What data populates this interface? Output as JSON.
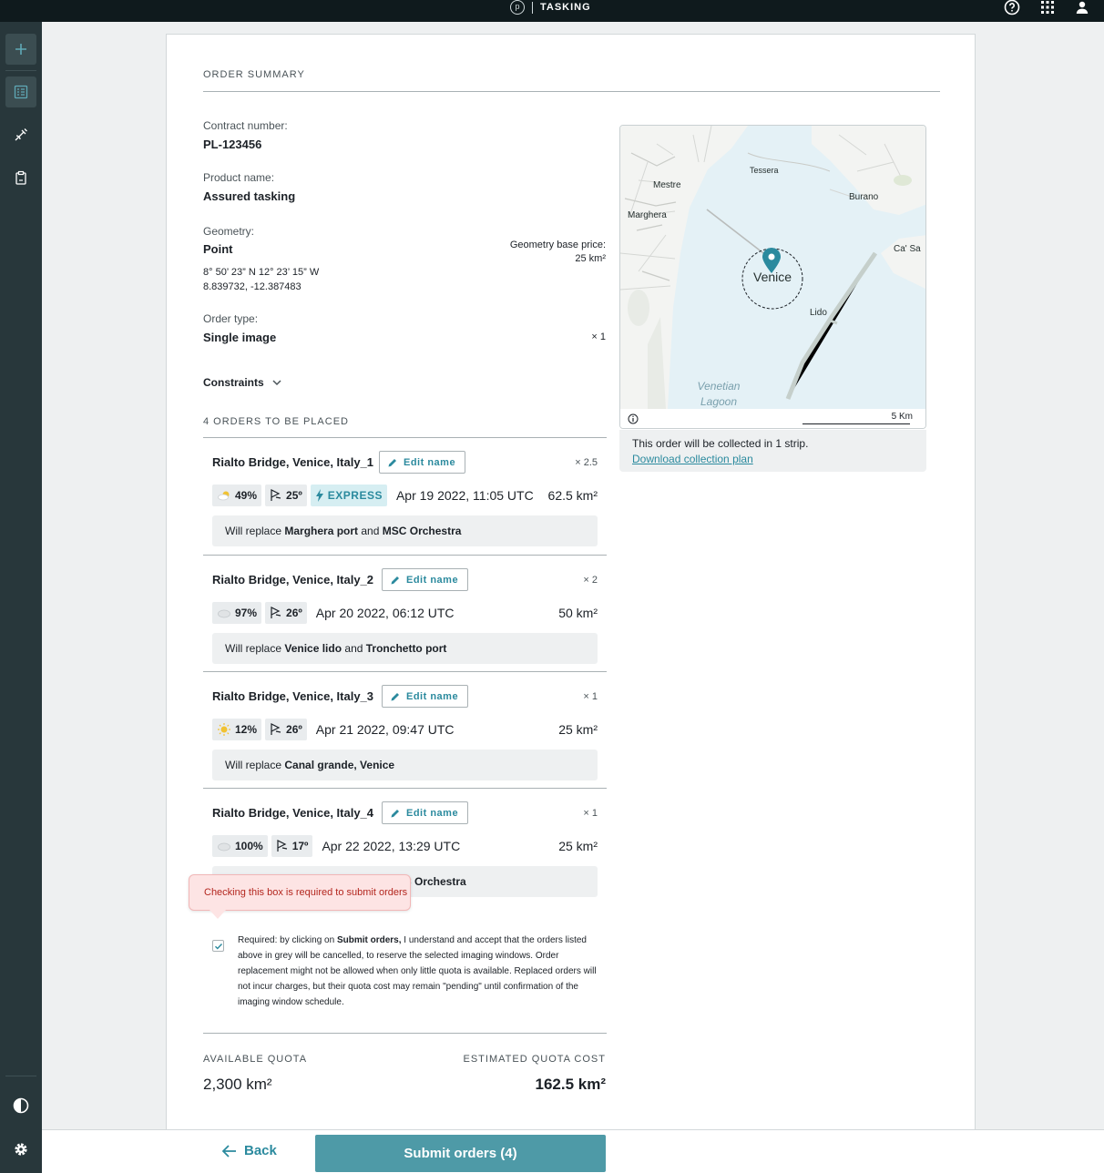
{
  "app": {
    "title": "TASKING",
    "logo_letter": "p"
  },
  "summary": {
    "title": "ORDER SUMMARY",
    "contract_label": "Contract number:",
    "contract_value": "PL-123456",
    "product_label": "Product name:",
    "product_value": "Assured tasking",
    "geometry_label": "Geometry:",
    "geometry_value": "Point",
    "geometry_price_label": "Geometry base price:",
    "geometry_price_value": "25 km²",
    "coords_dms": "8° 50’ 23” N  12° 23’ 15” W",
    "coords_decimal": "8.839732, -12.387483",
    "order_type_label": "Order type:",
    "order_type_value": "Single image",
    "order_type_mult": "× 1",
    "constraints_label": "Constraints"
  },
  "orders_title": "4 ORDERS TO BE PLACED",
  "edit_label": "Edit name",
  "orders": [
    {
      "name": "Rialto Bridge, Venice, Italy_1",
      "mult": "× 2.5",
      "cloud": "49%",
      "angle": "25º",
      "express": "EXPRESS",
      "date": "Apr 19 2022, 11:05 UTC",
      "area": "62.5 km²",
      "replace_prefix": "Will replace ",
      "replace_a": "Marghera port",
      "replace_and": " and ",
      "replace_b": "MSC Orchestra"
    },
    {
      "name": "Rialto Bridge, Venice, Italy_2",
      "mult": "× 2",
      "cloud": "97%",
      "angle": "26º",
      "date": "Apr 20 2022, 06:12 UTC",
      "area": "50 km²",
      "replace_prefix": "Will replace ",
      "replace_a": "Venice lido",
      "replace_and": " and ",
      "replace_b": "Tronchetto port"
    },
    {
      "name": "Rialto Bridge, Venice, Italy_3",
      "mult": "× 1",
      "cloud": "12%",
      "angle": "26º",
      "date": "Apr 21 2022, 09:47 UTC",
      "area": "25 km²",
      "replace_prefix": "Will replace ",
      "replace_a": "Canal grande, Venice"
    },
    {
      "name": "Rialto Bridge, Venice, Italy_4",
      "mult": "× 1",
      "cloud": "100%",
      "angle": "17º",
      "date": "Apr 22 2022, 13:29 UTC",
      "area": "25 km²",
      "replace_partial": "C Orchestra"
    }
  ],
  "tooltip": "Checking this box is required to submit orders",
  "consent": {
    "prefix": "Required: by clicking on ",
    "bold": "Submit orders,",
    "suffix": " I understand and accept that the orders listed above in grey will be cancelled, to reserve the selected imaging windows. Order replacement might not be allowed when only little quota is available. Replaced orders will not incur charges, but their quota cost may remain \"pending\" until confirmation of the imaging window schedule.",
    "checked": true
  },
  "quota": {
    "available_label": "AVAILABLE QUOTA",
    "available_value": "2,300 km²",
    "cost_label": "ESTIMATED QUOTA COST",
    "cost_value": "162.5 km²"
  },
  "map": {
    "labels": {
      "tessera": "Tessera",
      "mestre": "Mestre",
      "burano": "Burano",
      "marghera": "Marghera",
      "casa": "Ca' Sa",
      "venice": "Venice",
      "lido": "Lido",
      "lagoon": "Venetian Lagoon"
    },
    "scale": "5 Km",
    "info": "This order will be collected in 1 strip.",
    "download": "Download collection plan"
  },
  "footer": {
    "back": "Back",
    "submit": "Submit orders (4)"
  },
  "colors": {
    "accent": "#2b8a9e",
    "submit": "#4e9aa7",
    "topbar": "#0f1a1d",
    "sidebar": "#28373b",
    "error": "#b3261e"
  },
  "icons": [
    "help-icon",
    "apps-grid-icon",
    "user-icon",
    "plus-icon",
    "orders-list-icon",
    "satellite-icon",
    "clipboard-icon",
    "contrast-icon",
    "gear-icon",
    "chevron-down-icon",
    "pencil-icon",
    "cloud-icon",
    "angle-icon",
    "lightning-icon",
    "check-icon",
    "map-pin-icon",
    "info-icon",
    "arrow-left-icon"
  ]
}
